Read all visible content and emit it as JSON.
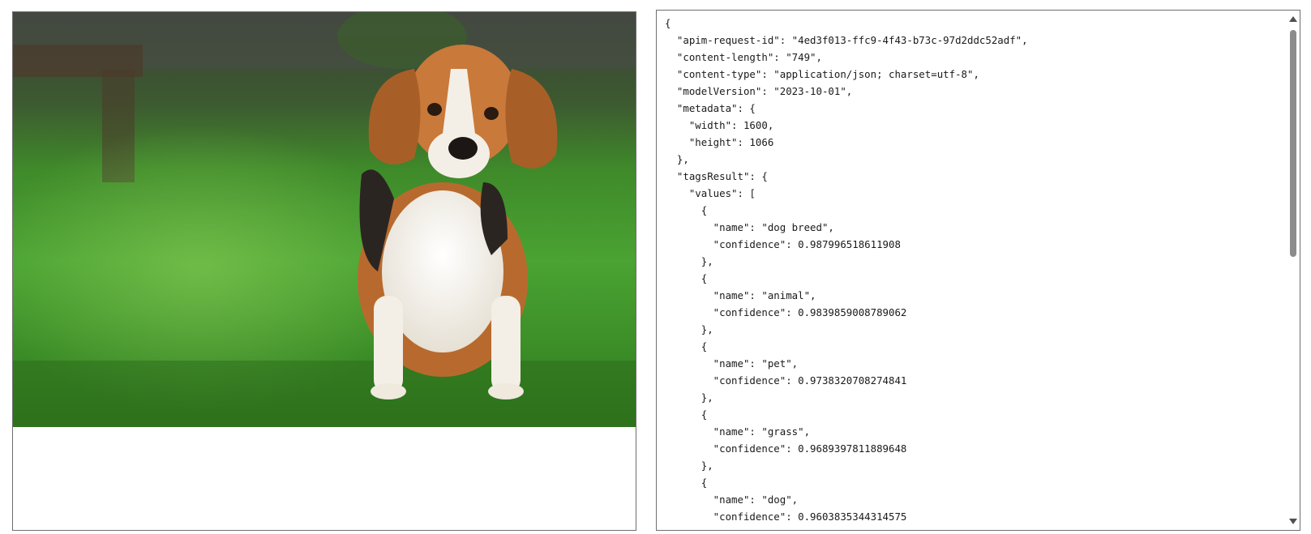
{
  "image_panel": {
    "subject": "beagle dog sitting on grass"
  },
  "json_output": {
    "lines": [
      "{",
      "  \"apim-request-id\": \"4ed3f013-ffc9-4f43-b73c-97d2ddc52adf\",",
      "  \"content-length\": \"749\",",
      "  \"content-type\": \"application/json; charset=utf-8\",",
      "  \"modelVersion\": \"2023-10-01\",",
      "  \"metadata\": {",
      "    \"width\": 1600,",
      "    \"height\": 1066",
      "  },",
      "  \"tagsResult\": {",
      "    \"values\": [",
      "      {",
      "        \"name\": \"dog breed\",",
      "        \"confidence\": 0.987996518611908",
      "      },",
      "      {",
      "        \"name\": \"animal\",",
      "        \"confidence\": 0.9839859008789062",
      "      },",
      "      {",
      "        \"name\": \"pet\",",
      "        \"confidence\": 0.9738320708274841",
      "      },",
      "      {",
      "        \"name\": \"grass\",",
      "        \"confidence\": 0.9689397811889648",
      "      },",
      "      {",
      "        \"name\": \"dog\",",
      "        \"confidence\": 0.9603835344314575"
    ]
  },
  "icons": {
    "scroll_up": "chevron-up-icon",
    "scroll_down": "chevron-down-icon"
  }
}
